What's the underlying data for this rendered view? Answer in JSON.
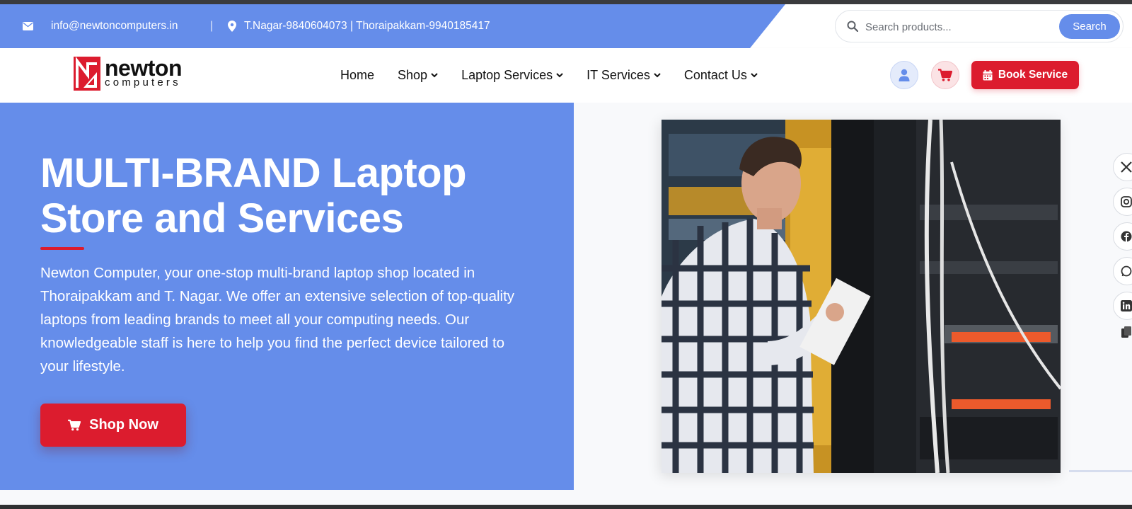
{
  "topbar": {
    "email": "info@newtoncomputers.in",
    "separator": "|",
    "phones": "T.Nagar-9840604073 | Thoraipakkam-9940185417",
    "search": {
      "placeholder": "Search products...",
      "button_label": "Search"
    }
  },
  "brand": {
    "name": "newton",
    "tagline": "computers"
  },
  "nav": {
    "items": [
      {
        "label": "Home",
        "dropdown": false
      },
      {
        "label": "Shop",
        "dropdown": true
      },
      {
        "label": "Laptop Services",
        "dropdown": true
      },
      {
        "label": "IT Services",
        "dropdown": true
      },
      {
        "label": "Contact Us",
        "dropdown": true
      }
    ],
    "book_label": "Book Service"
  },
  "hero": {
    "title_line1": "MULTI-BRAND Laptop",
    "title_line2": "Store and Services",
    "description": "Newton Computer, your one-stop multi-brand laptop shop located in Thoraipakkam and T. Nagar. We offer an extensive selection of top-quality laptops from leading brands to meet all your computing needs. Our knowledgeable staff is here to help you find the perfect device tailored to your lifestyle.",
    "cta_label": "Shop Now"
  },
  "social": [
    "x-icon",
    "instagram-icon",
    "facebook-icon",
    "whatsapp-icon",
    "linkedin-icon",
    "copy-icon"
  ],
  "colors": {
    "primary_blue": "#658dea",
    "accent_red": "#dc1c2e"
  }
}
